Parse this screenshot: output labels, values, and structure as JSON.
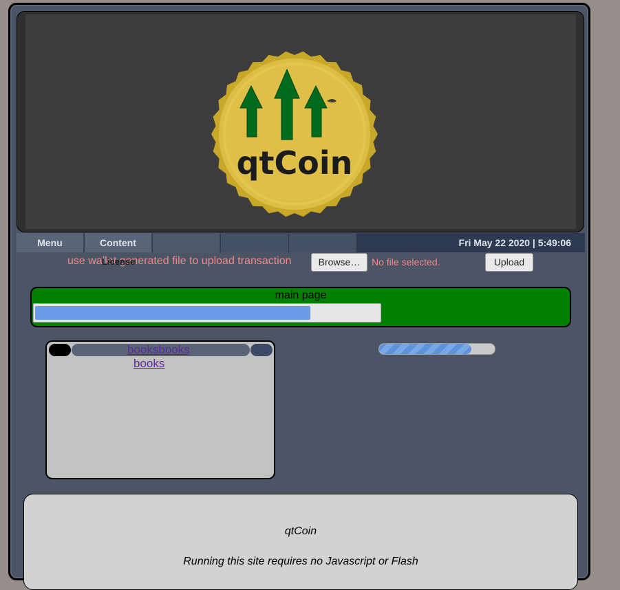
{
  "logo": {
    "text": "qtCoin"
  },
  "nav": {
    "items": [
      "Menu",
      "Content",
      "",
      "",
      ""
    ],
    "datetime": "Fri May 22 2020 | 5:49:06"
  },
  "upload": {
    "instruction": "use wallet generated file to upload transaction",
    "overlay_label": "License",
    "browse_label": "Browse…",
    "file_status": "No file selected.",
    "upload_label": "Upload"
  },
  "main": {
    "title": "main page",
    "progress": 0.8
  },
  "books": {
    "tab_label": "booksbooks",
    "link_label": "books"
  },
  "side_progress": 0.8,
  "footer": {
    "line1": "qtCoin",
    "line2": "Running this site requires no Javascript or Flash"
  },
  "colors": {
    "background": "#978d89",
    "frame": "#4b5566",
    "main_box": "#008000",
    "accent_text": "#f08a8a",
    "progress": "#6a9ae8"
  },
  "icons": [
    "qtcoin-logo-icon",
    "arrow-up-icon"
  ]
}
